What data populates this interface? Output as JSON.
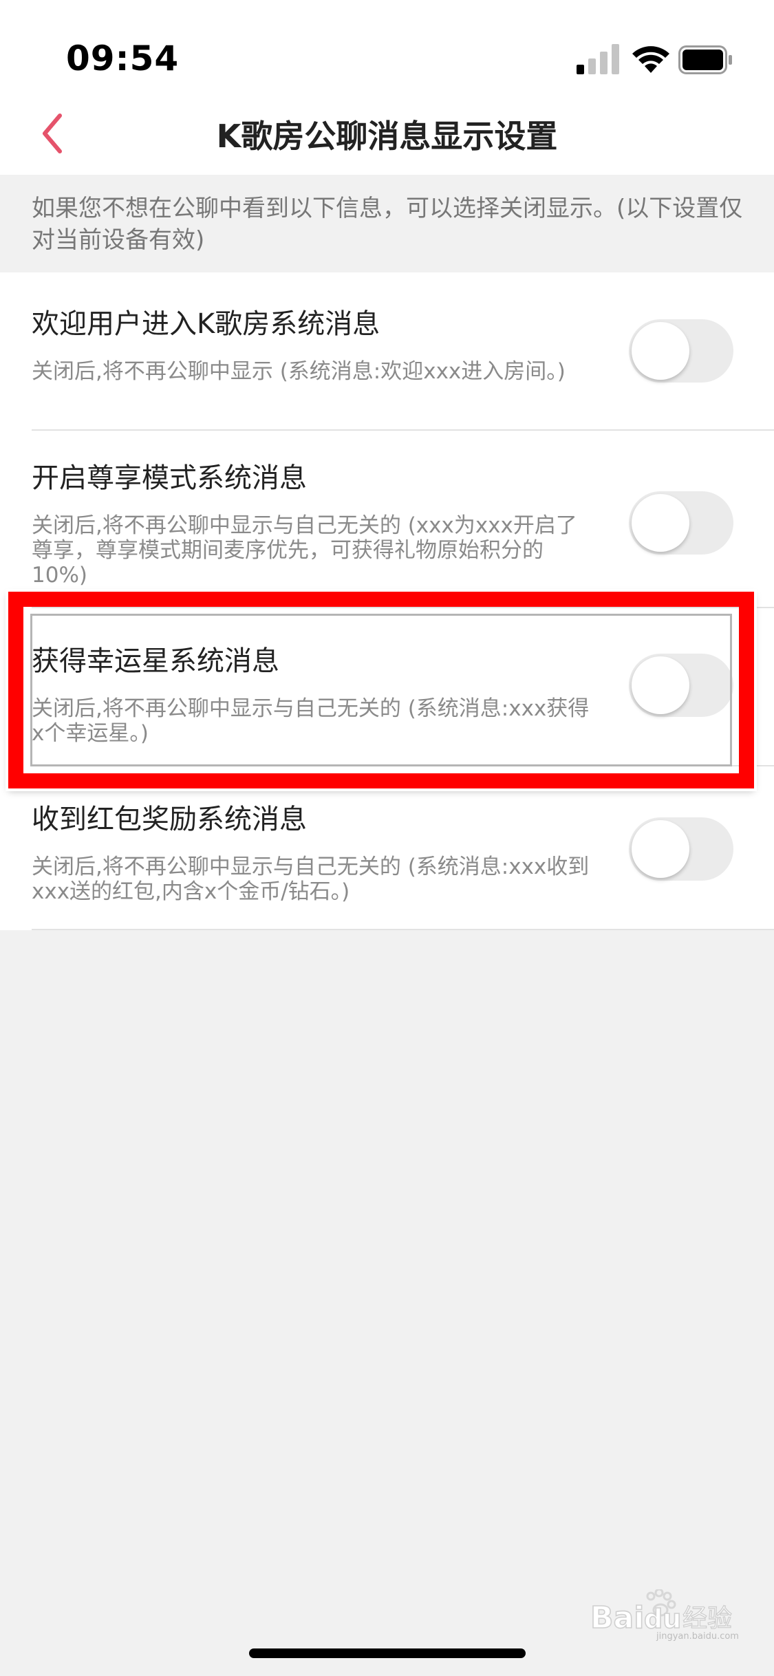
{
  "status_bar": {
    "time": "09:54",
    "icons": [
      "cellular-signal-icon",
      "wifi-icon",
      "battery-icon"
    ]
  },
  "nav": {
    "title": "K歌房公聊消息显示设置",
    "back_icon": "chevron-left-icon",
    "accent_color": "#e5536b"
  },
  "notice": {
    "text": "如果您不想在公聊中看到以下信息，可以选择关闭显示。(以下设置仅对当前设备有效)"
  },
  "settings": [
    {
      "title": "欢迎用户进入K歌房系统消息",
      "desc": "关闭后,将不再公聊中显示 (系统消息:欢迎xxx进入房间。)",
      "enabled": false
    },
    {
      "title": "开启尊享模式系统消息",
      "desc": "关闭后,将不再公聊中显示与自己无关的 (xxx为xxx开启了尊享，尊享模式期间麦序优先，可获得礼物原始积分的10%)",
      "enabled": false
    },
    {
      "title": "获得幸运星系统消息",
      "desc": "关闭后,将不再公聊中显示与自己无关的 (系统消息:xxx获得x个幸运星。)",
      "enabled": false
    },
    {
      "title": "收到红包奖励系统消息",
      "desc": "关闭后,将不再公聊中显示与自己无关的 (系统消息:xxx收到xxx送的红包,内含x个金币/钻石。)",
      "enabled": false
    }
  ],
  "highlight_color": "#ff0000",
  "watermark": {
    "brand": "Baidu",
    "label": "经验",
    "url": "jingyan.baidu.com"
  }
}
